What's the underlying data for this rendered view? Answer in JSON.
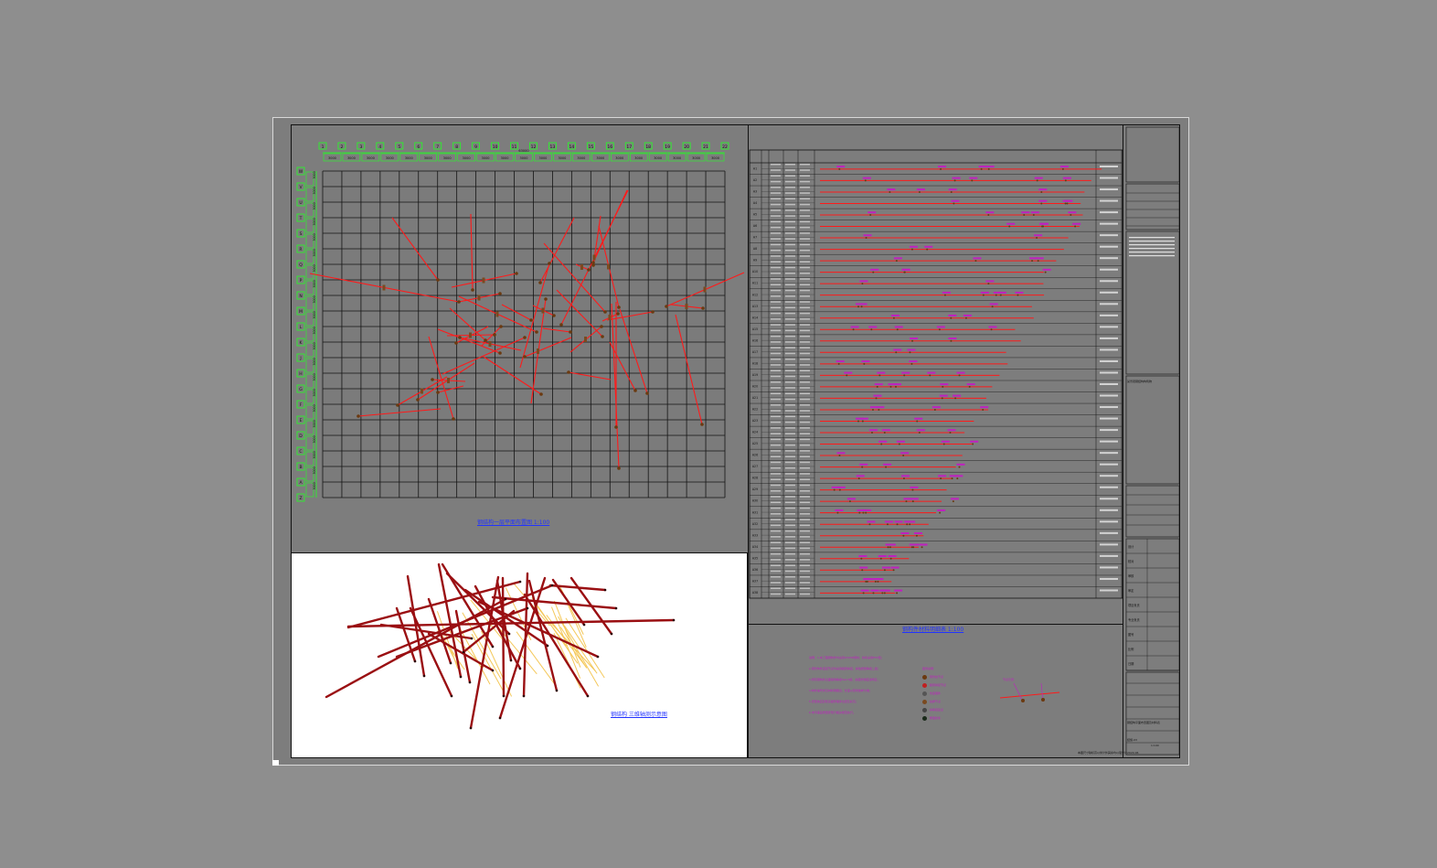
{
  "drawing": {
    "plan_caption": "钢结构一层平面布置图 1:100",
    "iso_caption": "钢结构 三维轴测示意图",
    "schedule_caption": "钢构件材料明细表 1:100",
    "bottom_note": "本图尺寸除标高以米计外其余均以毫米计",
    "grid_columns": [
      "1",
      "2",
      "3",
      "4",
      "5",
      "6",
      "7",
      "8",
      "9",
      "10",
      "11",
      "12",
      "13",
      "14",
      "15",
      "16",
      "17",
      "18",
      "19",
      "20",
      "21",
      "22"
    ],
    "grid_rows": [
      "W",
      "V",
      "U",
      "T",
      "S",
      "R",
      "Q",
      "P",
      "N",
      "M",
      "L",
      "K",
      "J",
      "H",
      "G",
      "F",
      "E",
      "D",
      "C",
      "B",
      "A",
      "Z"
    ],
    "column_spacing": "3000",
    "row_spacing": "3000",
    "overall_dim": "63000",
    "schedule_row_ids": [
      "A1",
      "A2",
      "A3",
      "A4",
      "A5",
      "A6",
      "A7",
      "A8",
      "A9",
      "A10",
      "A11",
      "A12",
      "A13",
      "A14",
      "A15",
      "A16",
      "A17",
      "A18",
      "A19",
      "A20",
      "A21",
      "A22",
      "A23",
      "A24",
      "A25",
      "A26",
      "A27",
      "A28",
      "A29",
      "A30",
      "A31",
      "A32",
      "A33",
      "A34",
      "A35",
      "A36",
      "A37",
      "A38"
    ],
    "notes": [
      "说明：1.本工程钢构件均采用Q345B钢材，焊条采用E50型；",
      "2.钢管构件连接节点均采用相贯焊接，焊缝质量等级二级；",
      "3.所有钢构件表面除锈等级Sa2.5级，涂装防锈底漆两道；",
      "4.构件编号详见材料明细表，长度以现场放样为准；",
      "5.安装前应复核基础预埋件位置及标高；",
      "6.未尽事宜按国家现行相关规范执行。"
    ],
    "legend_title": "图例说明：",
    "legend_items": [
      "钢管柱节点",
      "相贯焊接节点",
      "支座埋件",
      "柱脚节点",
      "斜撑连接点",
      "屋面檩条"
    ],
    "detail_title": "节点示意：",
    "title_block": {
      "project": "某景观钢结构构筑物",
      "drawing_name": "钢结构平面布置图及材料表",
      "scale": "1:100",
      "sheet_no": "结施-03",
      "date": "2020.06",
      "labels": [
        "设计",
        "校对",
        "审核",
        "审定",
        "项目负责",
        "专业负责",
        "图号",
        "比例",
        "日期"
      ]
    }
  }
}
